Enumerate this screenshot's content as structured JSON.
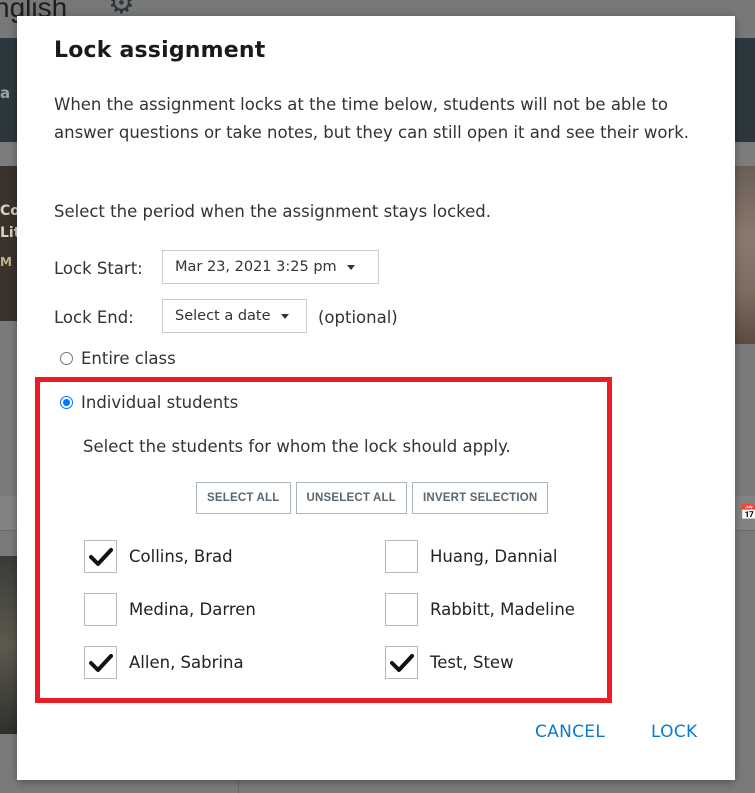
{
  "background": {
    "page_title_fragment": "nglish",
    "band_text_fragment": "a",
    "card_text_lines": [
      "Co",
      "Lit"
    ],
    "card_subtext": "M"
  },
  "dialog": {
    "title": "Lock assignment",
    "description": "When the assignment locks at the time below, students will not be able to answer questions or take notes, but they can still open it and see their work.",
    "period_instruction": "Select the period when the assignment stays locked.",
    "lock_start": {
      "label": "Lock Start:",
      "value": "Mar 23, 2021 3:25 pm"
    },
    "lock_end": {
      "label": "Lock End:",
      "value": "Select a date",
      "hint": "(optional)"
    },
    "scope_options": [
      {
        "label": "Entire class",
        "selected": false
      },
      {
        "label": "Individual students",
        "selected": true
      }
    ],
    "students_instruction": "Select the students for whom the lock should apply.",
    "selection_buttons": {
      "select_all": "SELECT ALL",
      "unselect_all": "UNSELECT ALL",
      "invert_selection": "INVERT SELECTION"
    },
    "students": [
      {
        "name": "Collins, Brad",
        "checked": true
      },
      {
        "name": "Huang, Dannial",
        "checked": false
      },
      {
        "name": "Medina, Darren",
        "checked": false
      },
      {
        "name": "Rabbitt, Madeline",
        "checked": false
      },
      {
        "name": "Allen, Sabrina",
        "checked": true
      },
      {
        "name": "Test, Stew",
        "checked": true
      }
    ],
    "footer": {
      "cancel": "CANCEL",
      "lock": "LOCK"
    }
  },
  "colors": {
    "accent_blue": "#0a7bd1",
    "radio_blue": "#0075ff",
    "highlight_red": "#ed1c24"
  }
}
